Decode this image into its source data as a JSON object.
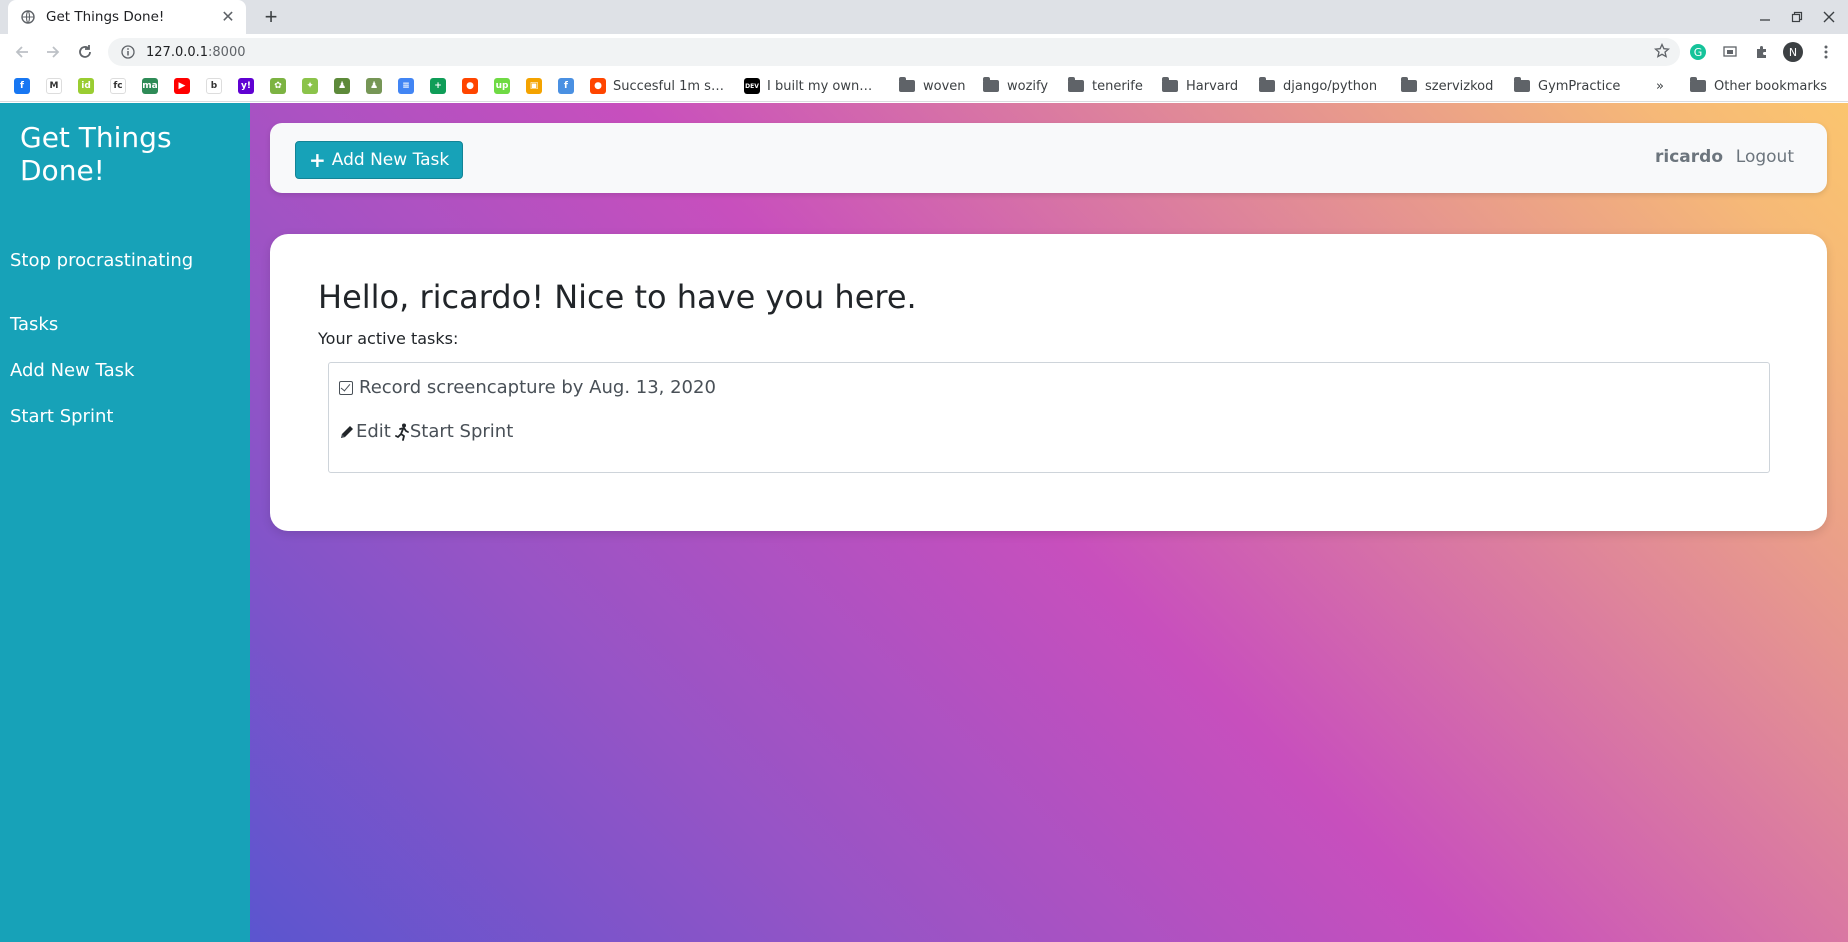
{
  "browser": {
    "tab_title": "Get Things Done!",
    "url_host": "127.0.0.1",
    "url_port": ":8000",
    "profile_initial": "N",
    "bookmarks": [
      {
        "icon": "facebook-icon",
        "label": "",
        "color": "#1877f2",
        "glyph": "f"
      },
      {
        "icon": "gmail-icon",
        "label": "",
        "color": "#ffffff",
        "glyph": "M"
      },
      {
        "icon": "id-icon",
        "label": "",
        "color": "#9acd32",
        "glyph": "id"
      },
      {
        "icon": "fc-icon",
        "label": "",
        "color": "#ffffff",
        "glyph": "fc"
      },
      {
        "icon": "ma-icon",
        "label": "",
        "color": "#2e8b57",
        "glyph": "ma"
      },
      {
        "icon": "youtube-icon",
        "label": "",
        "color": "#ff0000",
        "glyph": "▶"
      },
      {
        "icon": "b-icon",
        "label": "",
        "color": "#ffffff",
        "glyph": "b"
      },
      {
        "icon": "yahoo-icon",
        "label": "",
        "color": "#6001d2",
        "glyph": "y!"
      },
      {
        "icon": "leaf-icon",
        "label": "",
        "color": "#7cb342",
        "glyph": "✿"
      },
      {
        "icon": "bird-icon",
        "label": "",
        "color": "#8bc34a",
        "glyph": "✦"
      },
      {
        "icon": "chess-pawn-icon",
        "label": "",
        "color": "#5d8a3a",
        "glyph": "♟"
      },
      {
        "icon": "chess-board-icon",
        "label": "",
        "color": "#769656",
        "glyph": "♟"
      },
      {
        "icon": "docs-icon",
        "label": "",
        "color": "#4285f4",
        "glyph": "≡"
      },
      {
        "icon": "sheets-icon",
        "label": "",
        "color": "#0f9d58",
        "glyph": "+"
      },
      {
        "icon": "reddit-icon",
        "label": "",
        "color": "#ff4500",
        "glyph": "●"
      },
      {
        "icon": "upwork-icon",
        "label": "",
        "color": "#6fda44",
        "glyph": "up"
      },
      {
        "icon": "orange-app-icon",
        "label": "",
        "color": "#f4a300",
        "glyph": "▣"
      },
      {
        "icon": "fb-circle-icon",
        "label": "",
        "color": "#4a90e2",
        "glyph": "f"
      },
      {
        "icon": "reddit-icon",
        "label": "Succesful 1m s…",
        "color": "#ff4500",
        "glyph": "●"
      },
      {
        "icon": "dev-icon",
        "label": "I built my own…",
        "color": "#000000",
        "glyph": "DEV"
      }
    ],
    "folders": [
      "woven",
      "wozify",
      "tenerife",
      "Harvard",
      "django/python",
      "szervizkod",
      "GymPractice"
    ],
    "overflow": "»",
    "other_bookmarks": "Other bookmarks"
  },
  "sidebar": {
    "brand": "Get Things Done!",
    "tagline": "Stop procrastinating",
    "links": [
      "Tasks",
      "Add New Task",
      "Start Sprint"
    ]
  },
  "topbar": {
    "add_button": "Add New Task",
    "username": "ricardo",
    "logout": "Logout"
  },
  "main": {
    "greeting": "Hello, ricardo! Nice to have you here.",
    "active_label": "Your active tasks:",
    "tasks": [
      {
        "text": "Record screencapture by Aug. 13, 2020",
        "edit_label": "Edit",
        "sprint_label": "Start Sprint"
      }
    ]
  },
  "colors": {
    "sidebar": "#17a2b8",
    "accent": "#17a2b8"
  }
}
